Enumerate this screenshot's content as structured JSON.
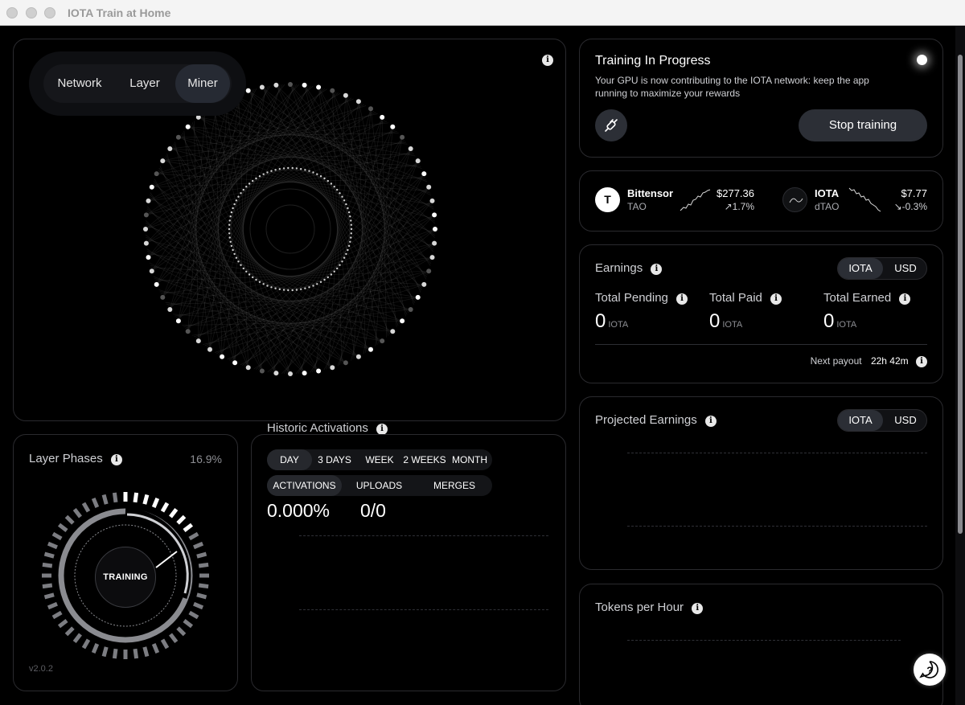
{
  "window": {
    "title": "IOTA Train at Home"
  },
  "network_panel": {
    "tabs": [
      "Network",
      "Layer",
      "Miner"
    ],
    "active_tab": "Miner"
  },
  "training": {
    "title": "Training In Progress",
    "description": "Your GPU is now contributing to the IOTA network: keep the app running to maximize your rewards",
    "stop_label": "Stop training"
  },
  "tickers": [
    {
      "badge": "T",
      "name": "Bittensor",
      "symbol": "TAO",
      "price": "$277.36",
      "change": "1.7%",
      "trend": "up"
    },
    {
      "badge": "",
      "name": "IOTA",
      "symbol": "dTAO",
      "price": "$7.77",
      "change": "-0.3%",
      "trend": "down"
    }
  ],
  "earnings": {
    "title": "Earnings",
    "toggle": [
      "IOTA",
      "USD"
    ],
    "stats": [
      {
        "label": "Total Pending",
        "value": "0",
        "unit": "IOTA"
      },
      {
        "label": "Total Paid",
        "value": "0",
        "unit": "IOTA"
      },
      {
        "label": "Total Earned",
        "value": "0",
        "unit": "IOTA"
      }
    ],
    "next_payout_label": "Next payout",
    "next_payout_value": "22h 42m"
  },
  "projected": {
    "title": "Projected Earnings",
    "toggle": [
      "IOTA",
      "USD"
    ]
  },
  "tokens": {
    "title": "Tokens per Hour"
  },
  "layer_phases": {
    "title": "Layer Phases",
    "percent": "16.9%",
    "center_label": "TRAINING",
    "version": "v2.0.2"
  },
  "historic": {
    "title": "Historic Activations",
    "ranges": [
      "DAY",
      "3 DAYS",
      "WEEK",
      "2 WEEKS",
      "MONTH"
    ],
    "metrics": [
      "ACTIVATIONS",
      "UPLOADS",
      "MERGES"
    ],
    "value_pct": "0.000%",
    "value_ratio": "0/0"
  }
}
